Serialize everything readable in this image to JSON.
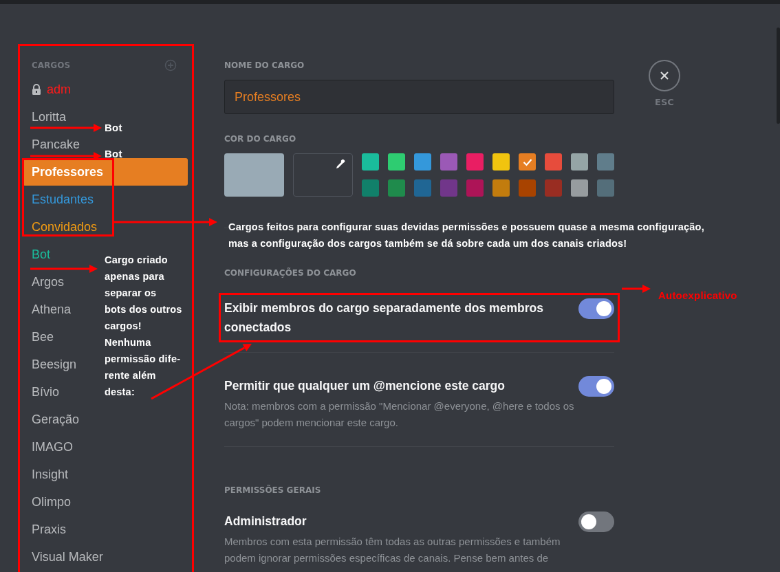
{
  "sidebar": {
    "title": "CARGOS",
    "roles": [
      {
        "name": "adm",
        "color": "#ff1a1a",
        "locked": true,
        "selected": false
      },
      {
        "name": "Loritta",
        "color": "#b9bbbe",
        "locked": false,
        "selected": false
      },
      {
        "name": "Pancake",
        "color": "#b9bbbe",
        "locked": false,
        "selected": false
      },
      {
        "name": "Professores",
        "color": "#e67e22",
        "locked": false,
        "selected": true
      },
      {
        "name": "Estudantes",
        "color": "#3498db",
        "locked": false,
        "selected": false
      },
      {
        "name": "Convidados",
        "color": "#f39c12",
        "locked": false,
        "selected": false
      },
      {
        "name": "Bot",
        "color": "#1abc9c",
        "locked": false,
        "selected": false
      },
      {
        "name": "Argos",
        "color": "#b9bbbe",
        "locked": false,
        "selected": false
      },
      {
        "name": "Athena",
        "color": "#b9bbbe",
        "locked": false,
        "selected": false
      },
      {
        "name": "Bee",
        "color": "#b9bbbe",
        "locked": false,
        "selected": false
      },
      {
        "name": "Beesign",
        "color": "#b9bbbe",
        "locked": false,
        "selected": false
      },
      {
        "name": "Bívio",
        "color": "#b9bbbe",
        "locked": false,
        "selected": false
      },
      {
        "name": "Geração",
        "color": "#b9bbbe",
        "locked": false,
        "selected": false
      },
      {
        "name": "IMAGO",
        "color": "#b9bbbe",
        "locked": false,
        "selected": false
      },
      {
        "name": "Insight",
        "color": "#b9bbbe",
        "locked": false,
        "selected": false
      },
      {
        "name": "Olimpo",
        "color": "#b9bbbe",
        "locked": false,
        "selected": false
      },
      {
        "name": "Praxis",
        "color": "#b9bbbe",
        "locked": false,
        "selected": false
      },
      {
        "name": "Visual Maker",
        "color": "#b9bbbe",
        "locked": false,
        "selected": false
      }
    ]
  },
  "role_name": {
    "label": "NOME DO CARGO",
    "value": "Professores"
  },
  "role_color": {
    "label": "COR DO CARGO",
    "swatches": [
      {
        "color": "#1abc9c",
        "selected": false
      },
      {
        "color": "#2ecc71",
        "selected": false
      },
      {
        "color": "#3498db",
        "selected": false
      },
      {
        "color": "#9b59b6",
        "selected": false
      },
      {
        "color": "#e91e63",
        "selected": false
      },
      {
        "color": "#f1c40f",
        "selected": false
      },
      {
        "color": "#e67e22",
        "selected": true
      },
      {
        "color": "#e74c3c",
        "selected": false
      },
      {
        "color": "#95a5a6",
        "selected": false
      },
      {
        "color": "#607d8b",
        "selected": false
      },
      {
        "color": "#11806a",
        "selected": false
      },
      {
        "color": "#1f8b4c",
        "selected": false
      },
      {
        "color": "#206694",
        "selected": false
      },
      {
        "color": "#71368a",
        "selected": false
      },
      {
        "color": "#ad1457",
        "selected": false
      },
      {
        "color": "#c27c0e",
        "selected": false
      },
      {
        "color": "#a84300",
        "selected": false
      },
      {
        "color": "#992d22",
        "selected": false
      },
      {
        "color": "#979c9f",
        "selected": false
      },
      {
        "color": "#546e7a",
        "selected": false
      }
    ]
  },
  "close": {
    "label": "ESC"
  },
  "sections": [
    {
      "title": "CONFIGURAÇÕES DO CARGO",
      "settings": [
        {
          "label": "Exibir membros do cargo separadamente dos membros conectados",
          "on": true,
          "annotated": true
        },
        {
          "label": "Permitir que qualquer um @mencione este cargo",
          "on": true,
          "annotated": false,
          "description": "Nota: membros com a permissão \"Mencionar @everyone, @here e todos os cargos\" podem mencionar este cargo."
        }
      ]
    },
    {
      "title": "PERMISSÕES GERAIS",
      "settings": [
        {
          "label": "Administrador",
          "on": false,
          "annotated": false,
          "description": "Membros com esta permissão têm todas as outras permissões e também podem ignorar permissões específicas de canais. Pense bem antes de"
        }
      ]
    }
  ],
  "annotations": {
    "loritta_note": "Bot",
    "pancake_note": "Bot",
    "roles_note": "Cargos feitos para configurar suas devidas permissões e possuem quase a mesma configuração,\nmas a configuração dos cargos também se dá sobre cada um dos canais criados!",
    "bot_note": "Cargo criado\napenas para\nseparar os\nbots dos outros\ncargos!\nNenhuma\npermissão dife-\nrente além\ndesta:",
    "toggle_note": "Autoexplicativo"
  }
}
